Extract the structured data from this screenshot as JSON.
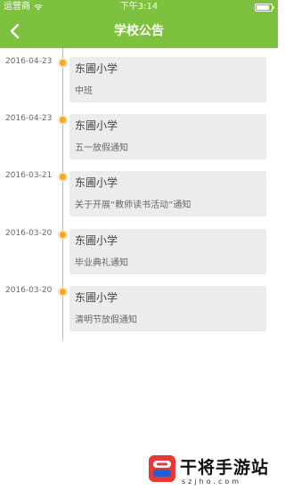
{
  "status_bar": {
    "carrier": "运营商",
    "time": "下午3:14"
  },
  "header": {
    "title": "学校公告",
    "back_icon": "chevron-left-icon"
  },
  "colors": {
    "brand": "#7dc13f",
    "dot": "#f5a623",
    "card_bg": "#ececec",
    "timeline": "#b8b8b8"
  },
  "announcements": [
    {
      "date": "2016-04-23",
      "school": "东圃小学",
      "title": "中班"
    },
    {
      "date": "2016-04-23",
      "school": "东圃小学",
      "title": "五一放假通知"
    },
    {
      "date": "2016-03-21",
      "school": "东圃小学",
      "title": "关于开展“教师读书活动”通知"
    },
    {
      "date": "2016-03-20",
      "school": "东圃小学",
      "title": "毕业典礼通知"
    },
    {
      "date": "2016-03-20",
      "school": "东圃小学",
      "title": "清明节放假通知"
    }
  ],
  "watermark": {
    "title": "干将手游站",
    "url": "szjho.com"
  }
}
